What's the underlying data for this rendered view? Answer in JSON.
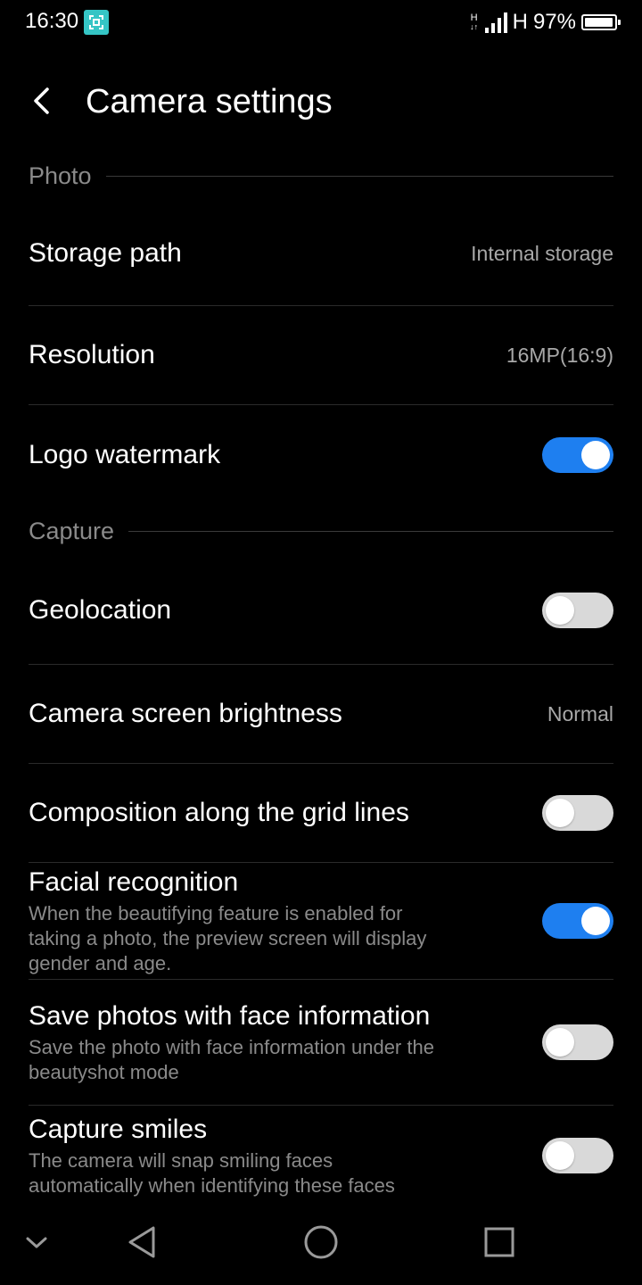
{
  "status_bar": {
    "time": "16:30",
    "network_type": "H",
    "network_arrows": "↓↑",
    "battery_text": "97%",
    "battery_level": 0.97,
    "signal_bars": 4,
    "icons": [
      "screenshot-app-icon",
      "signal-icon",
      "battery-icon"
    ]
  },
  "header": {
    "title": "Camera settings",
    "back_icon": "chevron-left-icon"
  },
  "sections": {
    "photo": {
      "label": "Photo",
      "storage_path": {
        "label": "Storage path",
        "value": "Internal storage"
      },
      "resolution": {
        "label": "Resolution",
        "value": "16MP(16:9)"
      },
      "logo_watermark": {
        "label": "Logo watermark",
        "enabled": true
      }
    },
    "capture": {
      "label": "Capture",
      "geolocation": {
        "label": "Geolocation",
        "enabled": false
      },
      "screen_brightness": {
        "label": "Camera screen brightness",
        "value": "Normal"
      },
      "grid_lines": {
        "label": "Composition along the grid lines",
        "enabled": false
      },
      "facial_recognition": {
        "label": "Facial recognition",
        "description": "When the beautifying feature is enabled for taking a photo, the preview screen will display gender and age.",
        "enabled": true
      },
      "save_face_info": {
        "label": "Save photos with face information",
        "description": "Save the photo with face information under the beautyshot mode",
        "enabled": false
      },
      "capture_smiles": {
        "label": "Capture smiles",
        "description": "The camera will snap smiling faces automatically when identifying these faces",
        "enabled": false
      }
    }
  },
  "nav_bar": {
    "icons": [
      "chevron-down-icon",
      "back-triangle-icon",
      "home-circle-icon",
      "recents-square-icon"
    ]
  },
  "colors": {
    "background": "#000000",
    "accent": "#1e7ff0",
    "toggle_off": "#d9d9d9",
    "secondary_text": "#8a8a8a",
    "status_icon": "#35c5c5"
  }
}
